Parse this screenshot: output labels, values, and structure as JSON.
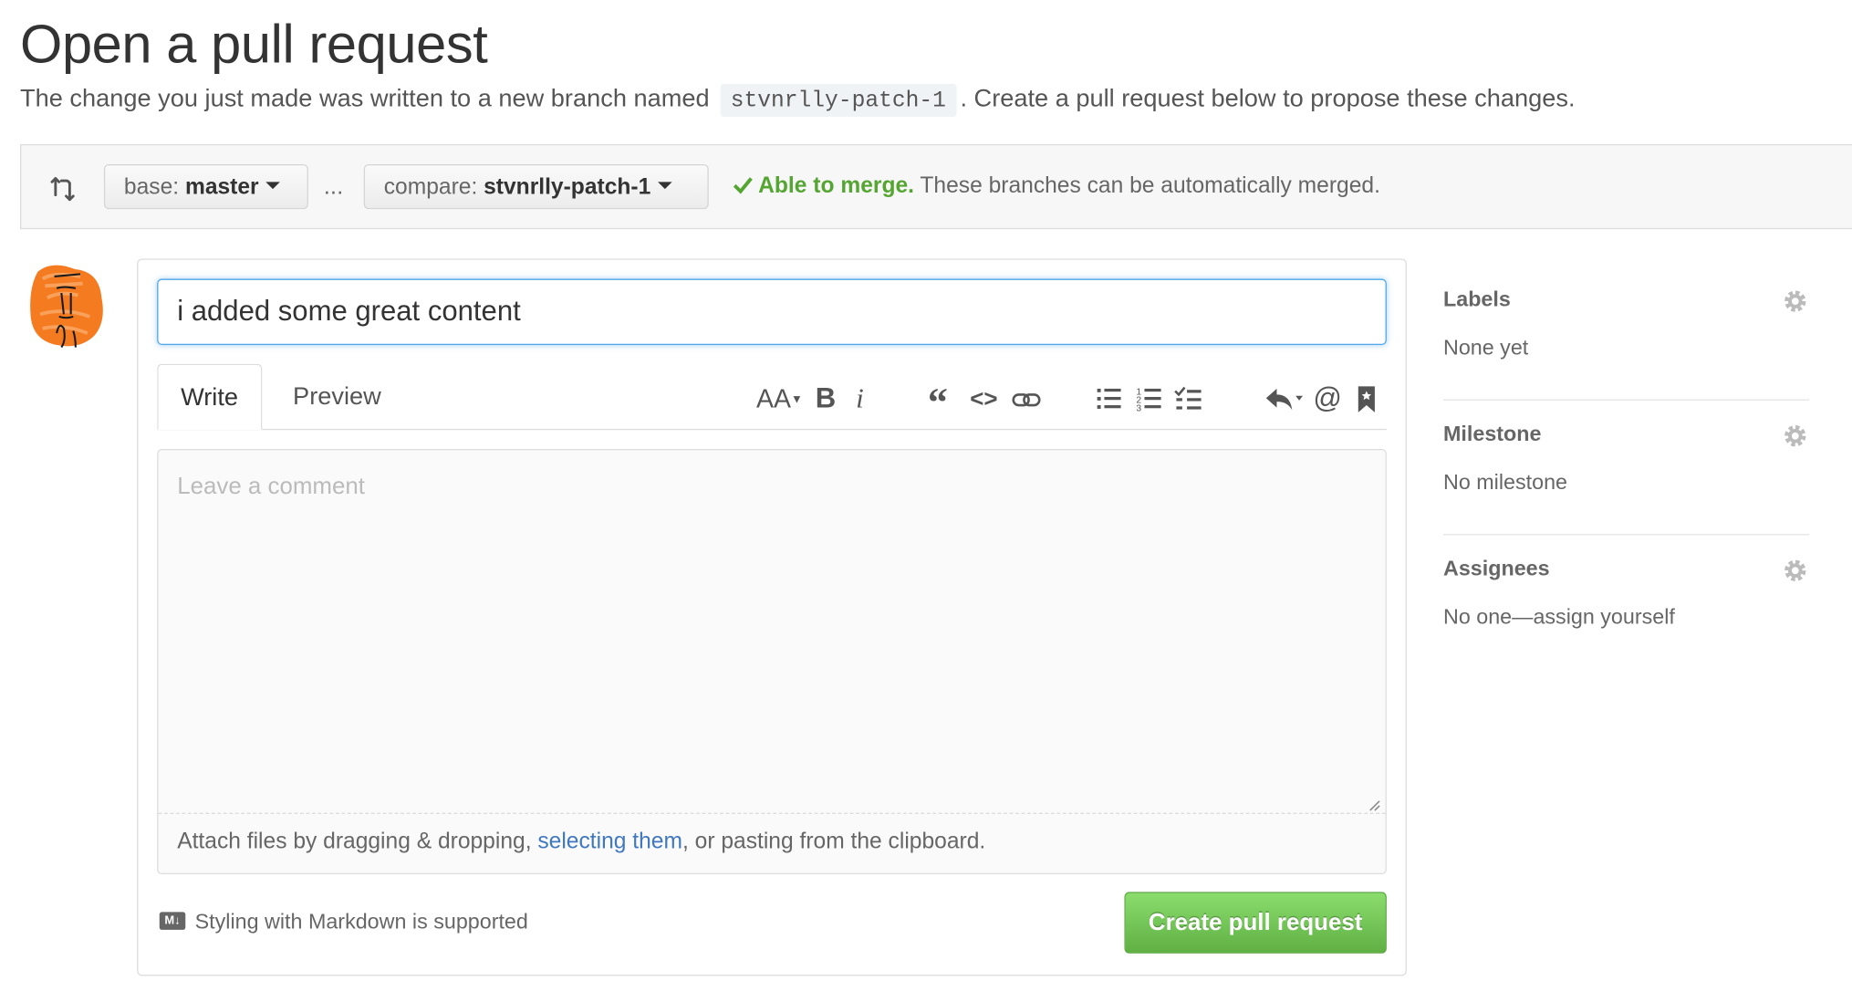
{
  "header": {
    "title": "Open a pull request",
    "subtitle_before": "The change you just made was written to a new branch named",
    "branch_name": "stvnrlly-patch-1",
    "subtitle_after": ". Create a pull request below to propose these changes."
  },
  "range": {
    "icon": "git-compare-icon",
    "base_label": "base:",
    "base_value": "master",
    "separator": "...",
    "compare_label": "compare:",
    "compare_value": "stvnrlly-patch-1",
    "merge_status": "Able to merge.",
    "merge_detail": "These branches can be automatically merged.",
    "status_color": "#55a532"
  },
  "form": {
    "title_value": "i added some great content",
    "tabs": [
      "Write",
      "Preview"
    ],
    "toolbar_icons": [
      "text-size-icon",
      "bold-icon",
      "italic-icon",
      "quote-icon",
      "code-icon",
      "link-icon",
      "unordered-list-icon",
      "ordered-list-icon",
      "task-list-icon",
      "reply-icon",
      "mention-icon",
      "bookmark-icon"
    ],
    "comment_placeholder": "Leave a comment",
    "attach_before": "Attach files by dragging & dropping, ",
    "attach_link": "selecting them",
    "attach_after": ", or pasting from the clipboard.",
    "markdown_note": "Styling with Markdown is supported",
    "submit_label": "Create pull request",
    "submit_color": "#6cc644"
  },
  "sidebar": {
    "sections": [
      {
        "heading": "Labels",
        "value": "None yet"
      },
      {
        "heading": "Milestone",
        "value": "No milestone"
      },
      {
        "heading": "Assignees",
        "value": "No one—assign yourself"
      }
    ]
  }
}
